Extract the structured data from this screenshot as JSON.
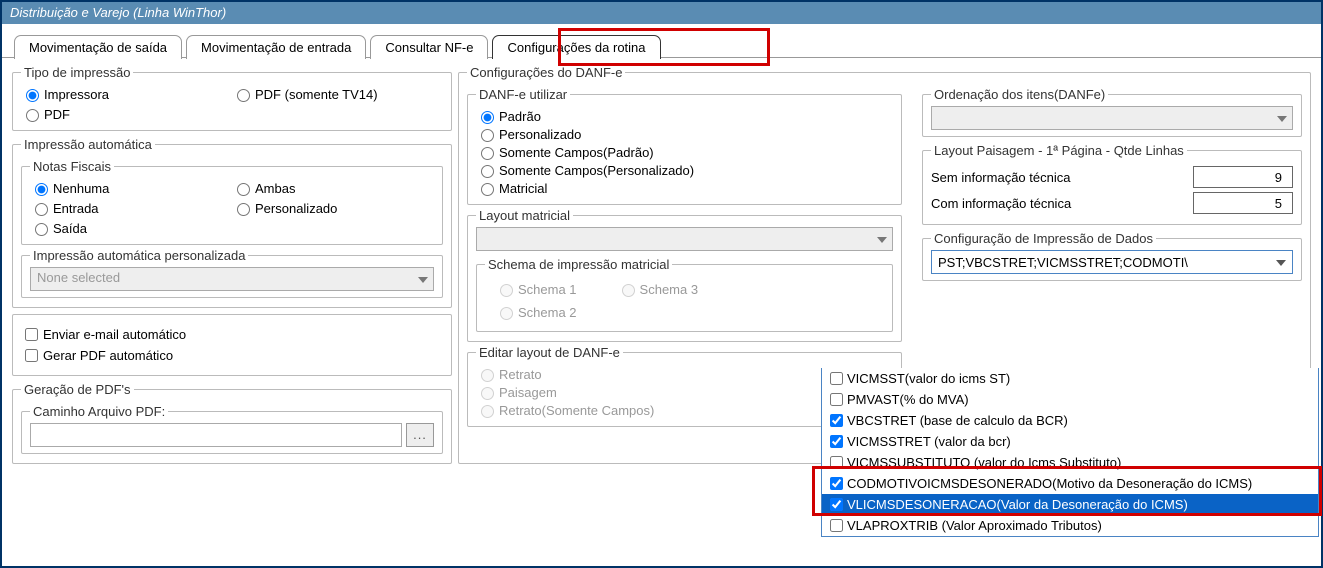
{
  "window_title": "Distribuição e Varejo (Linha WinThor)",
  "tabs": [
    "Movimentação de saída",
    "Movimentação de entrada",
    "Consultar NF-e",
    "Configurações da rotina"
  ],
  "active_tab_index": 3,
  "tipo_impressao": {
    "legend": "Tipo de impressão",
    "options": [
      "Impressora",
      "PDF (somente TV14)",
      "PDF"
    ],
    "selected": "Impressora"
  },
  "impressao_auto": {
    "legend": "Impressão automática",
    "notas_legend": "Notas Fiscais",
    "options": [
      "Nenhuma",
      "Ambas",
      "Entrada",
      "Personalizado",
      "Saída"
    ],
    "selected": "Nenhuma",
    "pers_legend": "Impressão automática personalizada",
    "pers_value": "None selected"
  },
  "auto_checks": {
    "email": "Enviar e-mail automático",
    "pdf": "Gerar PDF automático"
  },
  "geracao_pdf": {
    "legend": "Geração de PDF's",
    "caminho_legend": "Caminho Arquivo PDF:",
    "browse": "..."
  },
  "danfe": {
    "legend": "Configurações do DANF-e",
    "utilizar_legend": "DANF-e utilizar",
    "utilizar_options": [
      "Padrão",
      "Personalizado",
      "Somente Campos(Padrão)",
      "Somente Campos(Personalizado)",
      "Matricial"
    ],
    "utilizar_selected": "Padrão",
    "layout_matricial_legend": "Layout matricial",
    "schema_legend": "Schema de impressão matricial",
    "schema_options": [
      "Schema 1",
      "Schema 3",
      "Schema 2"
    ],
    "editar_legend": "Editar layout de DANF-e",
    "editar_options": [
      "Retrato",
      "Paisagem",
      "Retrato(Somente Campos)"
    ]
  },
  "ordenacao": {
    "legend": "Ordenação dos itens(DANFe)"
  },
  "layout_paisagem": {
    "legend": "Layout Paisagem - 1ª Página - Qtde Linhas",
    "sem_label": "Sem informação técnica",
    "sem_value": "9",
    "com_label": "Com informação técnica",
    "com_value": "5"
  },
  "config_impressao_dados": {
    "legend": "Configuração de Impressão de Dados",
    "combo_text": "PST;VBCSTRET;VICMSSTRET;CODMOTI\\",
    "items": [
      {
        "label": "VICMSST(valor do icms ST)",
        "checked": false
      },
      {
        "label": "PMVAST(% do MVA)",
        "checked": false
      },
      {
        "label": "VBCSTRET (base de calculo da BCR)",
        "checked": true
      },
      {
        "label": "VICMSSTRET (valor da bcr)",
        "checked": true
      },
      {
        "label": "VICMSSUBSTITUTO (valor do Icms Substituto)",
        "checked": false
      },
      {
        "label": "CODMOTIVOICMSDESONERADO(Motivo da Desoneração do ICMS)",
        "checked": true
      },
      {
        "label": "VLICMSDESONERACAO(Valor da Desoneração do ICMS)",
        "checked": true,
        "selected": true
      },
      {
        "label": "VLAPROXTRIB (Valor Aproximado Tributos)",
        "checked": false
      }
    ]
  }
}
